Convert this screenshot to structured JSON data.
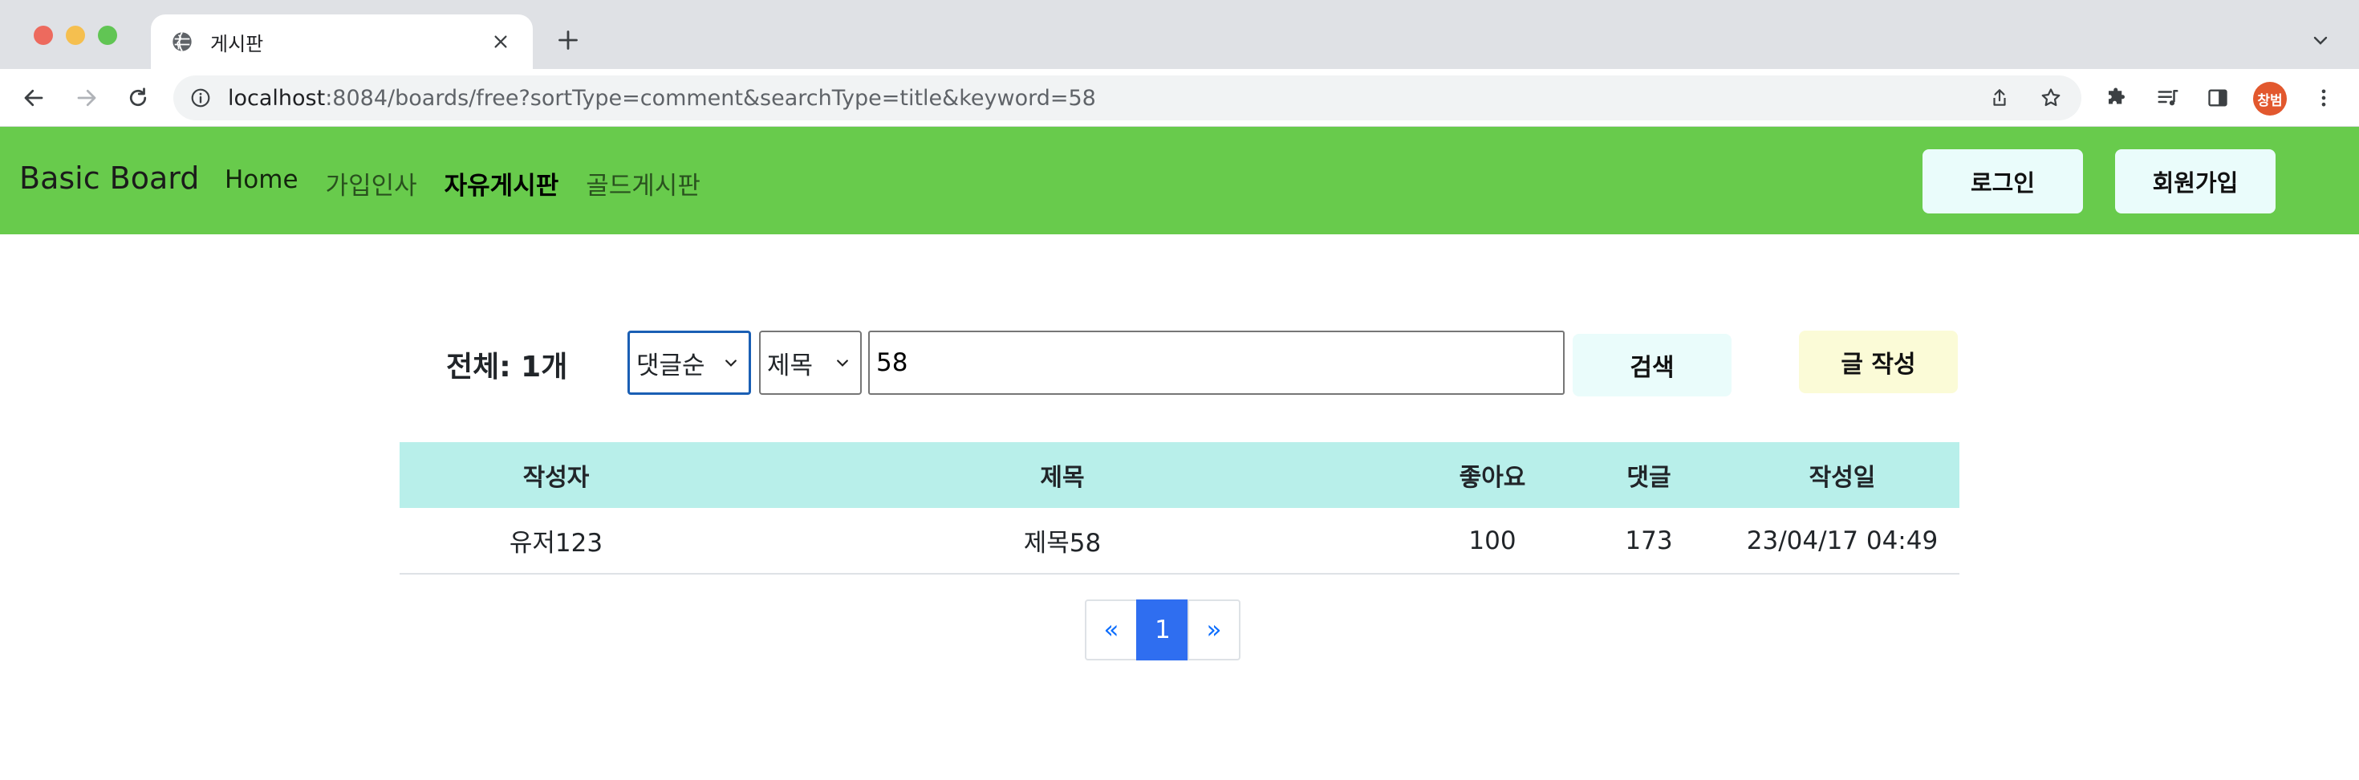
{
  "browser": {
    "tab_title": "게시판",
    "url_host": "localhost",
    "url_rest": ":8084/boards/free?sortType=comment&searchType=title&keyword=58",
    "profile_initials": "창범"
  },
  "navbar": {
    "brand": "Basic Board",
    "links": [
      {
        "label": "Home"
      },
      {
        "label": "가입인사"
      },
      {
        "label": "자유게시판"
      },
      {
        "label": "골드게시판"
      }
    ],
    "login_label": "로그인",
    "signup_label": "회원가입"
  },
  "search": {
    "total_label": "전체: 1개",
    "sort_selected": "댓글순",
    "type_selected": "제목",
    "keyword": "58",
    "search_label": "검색",
    "write_label": "글 작성"
  },
  "table": {
    "headers": [
      "작성자",
      "제목",
      "좋아요",
      "댓글",
      "작성일"
    ],
    "rows": [
      [
        "유저123",
        "제목58",
        "100",
        "173",
        "23/04/17 04:49"
      ]
    ]
  },
  "pagination": {
    "prev": "«",
    "pages": [
      "1"
    ],
    "next": "»"
  },
  "colors": {
    "navbar_bg": "#68cb4c",
    "table_header_bg": "#b8efea",
    "write_btn_bg": "#fbfbd7",
    "light_btn_bg": "#eafcfb",
    "active_page_bg": "#2f6ef0"
  }
}
